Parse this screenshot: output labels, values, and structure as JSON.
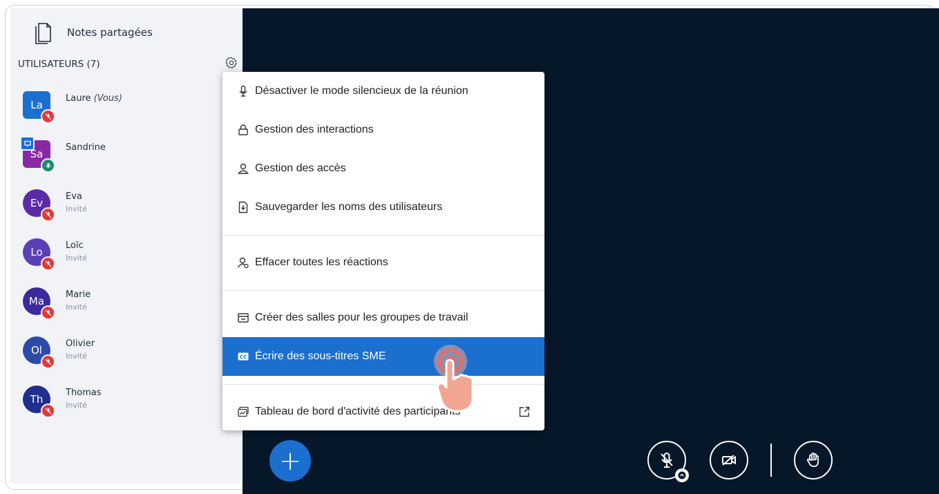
{
  "sidebar": {
    "notes_label": "Notes partagées",
    "users_header": "UTILISATEURS (7)",
    "users": [
      {
        "initials": "La",
        "name": "Laure",
        "suffix": "(Vous)",
        "role": "",
        "color": "#1b6fd1",
        "shape": "square",
        "mic": "muted"
      },
      {
        "initials": "Sa",
        "name": "Sandrine",
        "suffix": "",
        "role": "",
        "color": "#8a2aa3",
        "shape": "square",
        "mic": "active",
        "presenter": true
      },
      {
        "initials": "Ev",
        "name": "Eva",
        "suffix": "",
        "role": "Invité",
        "color": "#5b2aa6",
        "shape": "circle",
        "mic": "muted"
      },
      {
        "initials": "Lo",
        "name": "Loïc",
        "suffix": "",
        "role": "Invité",
        "color": "#5b3fb8",
        "shape": "circle",
        "mic": "muted"
      },
      {
        "initials": "Ma",
        "name": "Marie",
        "suffix": "",
        "role": "Invité",
        "color": "#3b2a9c",
        "shape": "circle",
        "mic": "muted"
      },
      {
        "initials": "Ol",
        "name": "Olivier",
        "suffix": "",
        "role": "Invité",
        "color": "#2e4aa8",
        "shape": "circle",
        "mic": "muted"
      },
      {
        "initials": "Th",
        "name": "Thomas",
        "suffix": "",
        "role": "Invité",
        "color": "#1f2f8c",
        "shape": "circle",
        "mic": "muted"
      }
    ]
  },
  "menu": {
    "items": [
      {
        "label": "Désactiver le mode silencieux de la réunion",
        "icon": "microphone-icon"
      },
      {
        "label": "Gestion des interactions",
        "icon": "lock-icon"
      },
      {
        "label": "Gestion des accès",
        "icon": "user-icon"
      },
      {
        "label": "Sauvegarder les noms des utilisateurs",
        "icon": "download-file-icon"
      },
      {
        "label": "Effacer toutes les réactions",
        "icon": "user-clear-icon"
      },
      {
        "label": "Créer des salles pour les groupes de travail",
        "icon": "rooms-icon"
      },
      {
        "label": "Écrire des sous-titres SME",
        "icon": "closed-captions-icon",
        "active": true
      },
      {
        "label": "Tableau de bord d'activité des participants",
        "icon": "dashboard-icon"
      }
    ]
  },
  "controls": {
    "plus_label": "+"
  },
  "colors": {
    "stage_bg": "#06172a",
    "accent": "#1a6fcf",
    "muted_badge": "#e53935",
    "active_badge": "#1e8a6e"
  }
}
